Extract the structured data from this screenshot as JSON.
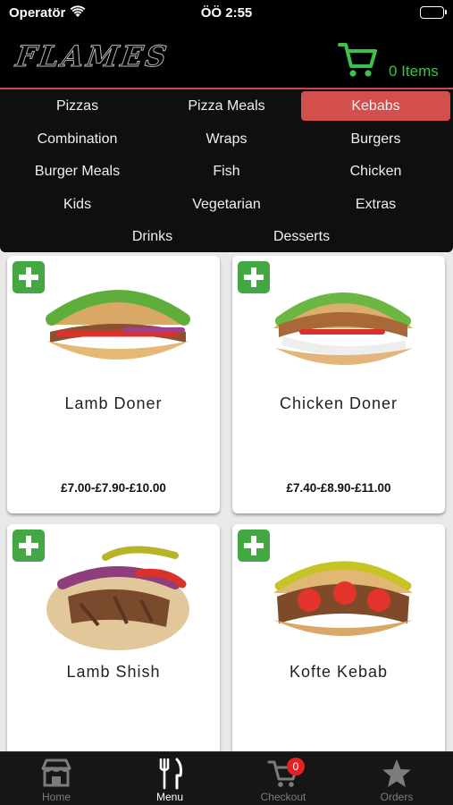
{
  "status_bar": {
    "carrier": "Operatör",
    "time": "ÖÖ 2:55"
  },
  "header": {
    "logo_text": "FLAMES",
    "cart_count": "0 Items",
    "accent_color": "#3cc24a"
  },
  "categories": [
    {
      "label": "Pizzas",
      "active": false
    },
    {
      "label": "Pizza Meals",
      "active": false
    },
    {
      "label": "Kebabs",
      "active": true
    },
    {
      "label": "Combination",
      "active": false
    },
    {
      "label": "Wraps",
      "active": false
    },
    {
      "label": "Burgers",
      "active": false
    },
    {
      "label": "Burger Meals",
      "active": false
    },
    {
      "label": "Fish",
      "active": false
    },
    {
      "label": "Chicken",
      "active": false
    },
    {
      "label": "Kids",
      "active": false
    },
    {
      "label": "Vegetarian",
      "active": false
    },
    {
      "label": "Extras",
      "active": false
    },
    {
      "label": "Drinks",
      "active": false
    },
    {
      "label": "Desserts",
      "active": false
    }
  ],
  "items": [
    {
      "name": "Lamb Doner",
      "price": "£7.00-£7.90-£10.00"
    },
    {
      "name": "Chicken Doner",
      "price": "£7.40-£8.90-£11.00"
    },
    {
      "name": "Lamb Shish",
      "price": ""
    },
    {
      "name": "Kofte Kebab",
      "price": ""
    }
  ],
  "tabs": [
    {
      "label": "Home",
      "icon": "store-icon",
      "active": false
    },
    {
      "label": "Menu",
      "icon": "fork-knife-icon",
      "active": true
    },
    {
      "label": "Checkout",
      "icon": "cart-icon",
      "active": false,
      "badge": "0"
    },
    {
      "label": "Orders",
      "icon": "star-icon",
      "active": false
    }
  ],
  "colors": {
    "active_category": "#d24f4b",
    "add_button": "#43a843",
    "badge": "#e32222"
  }
}
